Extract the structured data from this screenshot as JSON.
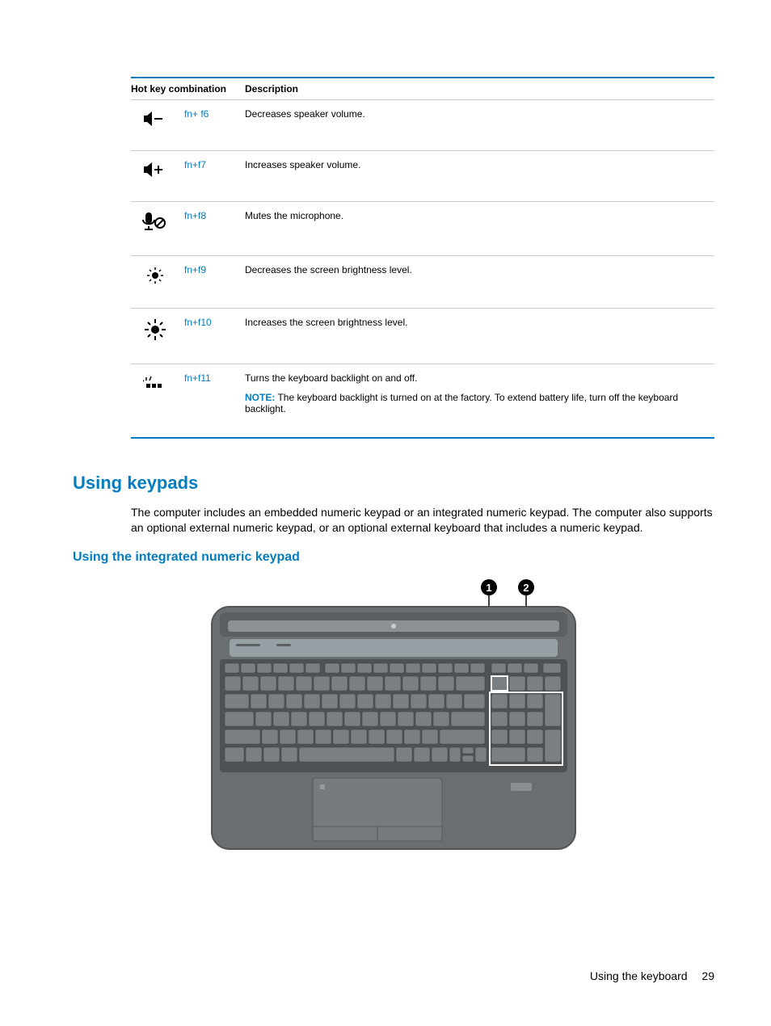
{
  "table": {
    "headers": {
      "col1": "Hot key combination",
      "col2": "Description"
    },
    "rows": [
      {
        "keys": "fn+ f6",
        "desc": "Decreases speaker volume."
      },
      {
        "keys": "fn+f7",
        "desc": "Increases speaker volume."
      },
      {
        "keys": "fn+f8",
        "desc": "Mutes the microphone."
      },
      {
        "keys": "fn+f9",
        "desc": "Decreases the screen brightness level."
      },
      {
        "keys": "fn+f10",
        "desc": "Increases the screen brightness level."
      },
      {
        "keys": "fn+f11",
        "desc": "Turns the keyboard backlight on and off.",
        "noteLabel": "NOTE:",
        "noteText": "The keyboard backlight is turned on at the factory. To extend battery life, turn off the keyboard backlight."
      }
    ]
  },
  "section": {
    "heading": "Using keypads",
    "para": "The computer includes an embedded numeric keypad or an integrated numeric keypad. The computer also supports an optional external numeric keypad, or an optional external keyboard that includes a numeric keypad.",
    "subheading": "Using the integrated numeric keypad"
  },
  "footer": {
    "text": "Using the keyboard",
    "page": "29"
  },
  "callouts": {
    "c1": "1",
    "c2": "2"
  }
}
